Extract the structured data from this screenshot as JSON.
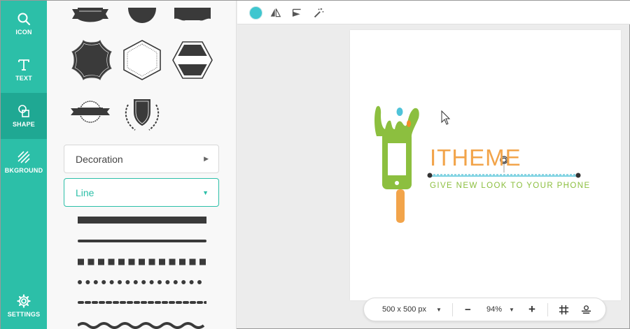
{
  "sidebar": {
    "items": [
      {
        "label": "ICON",
        "icon": "search-icon"
      },
      {
        "label": "TEXT",
        "icon": "text-icon"
      },
      {
        "label": "SHAPE",
        "icon": "shape-icon",
        "active": true
      },
      {
        "label": "BKGROUND",
        "icon": "background-icon"
      },
      {
        "label": "SETTINGS",
        "icon": "gear-icon"
      }
    ]
  },
  "panel": {
    "categories": [
      {
        "label": "Decoration",
        "expanded": false
      },
      {
        "label": "Line",
        "expanded": true
      }
    ],
    "line_styles": [
      "solid-thick",
      "solid-thin",
      "square-dashed",
      "dotted",
      "dashed",
      "wavy"
    ]
  },
  "toolbar": {
    "color": "#3fc6cf",
    "tools": [
      "flip-horizontal-icon",
      "align-icon",
      "magic-wand-icon"
    ]
  },
  "canvas": {
    "logo_title": "ITHEME",
    "logo_tagline": "GIVE NEW LOOK TO YOUR PHONE",
    "colors": {
      "title": "#f2a44a",
      "tagline": "#8cbf3f",
      "phone": "#8cbf3f",
      "stick": "#f2a44a",
      "drop_blue": "#4fc3d9",
      "drop_orange": "#f28c28"
    }
  },
  "bottombar": {
    "size_label": "500 x 500 px",
    "zoom_label": "94%",
    "minus": "−",
    "plus": "+"
  }
}
